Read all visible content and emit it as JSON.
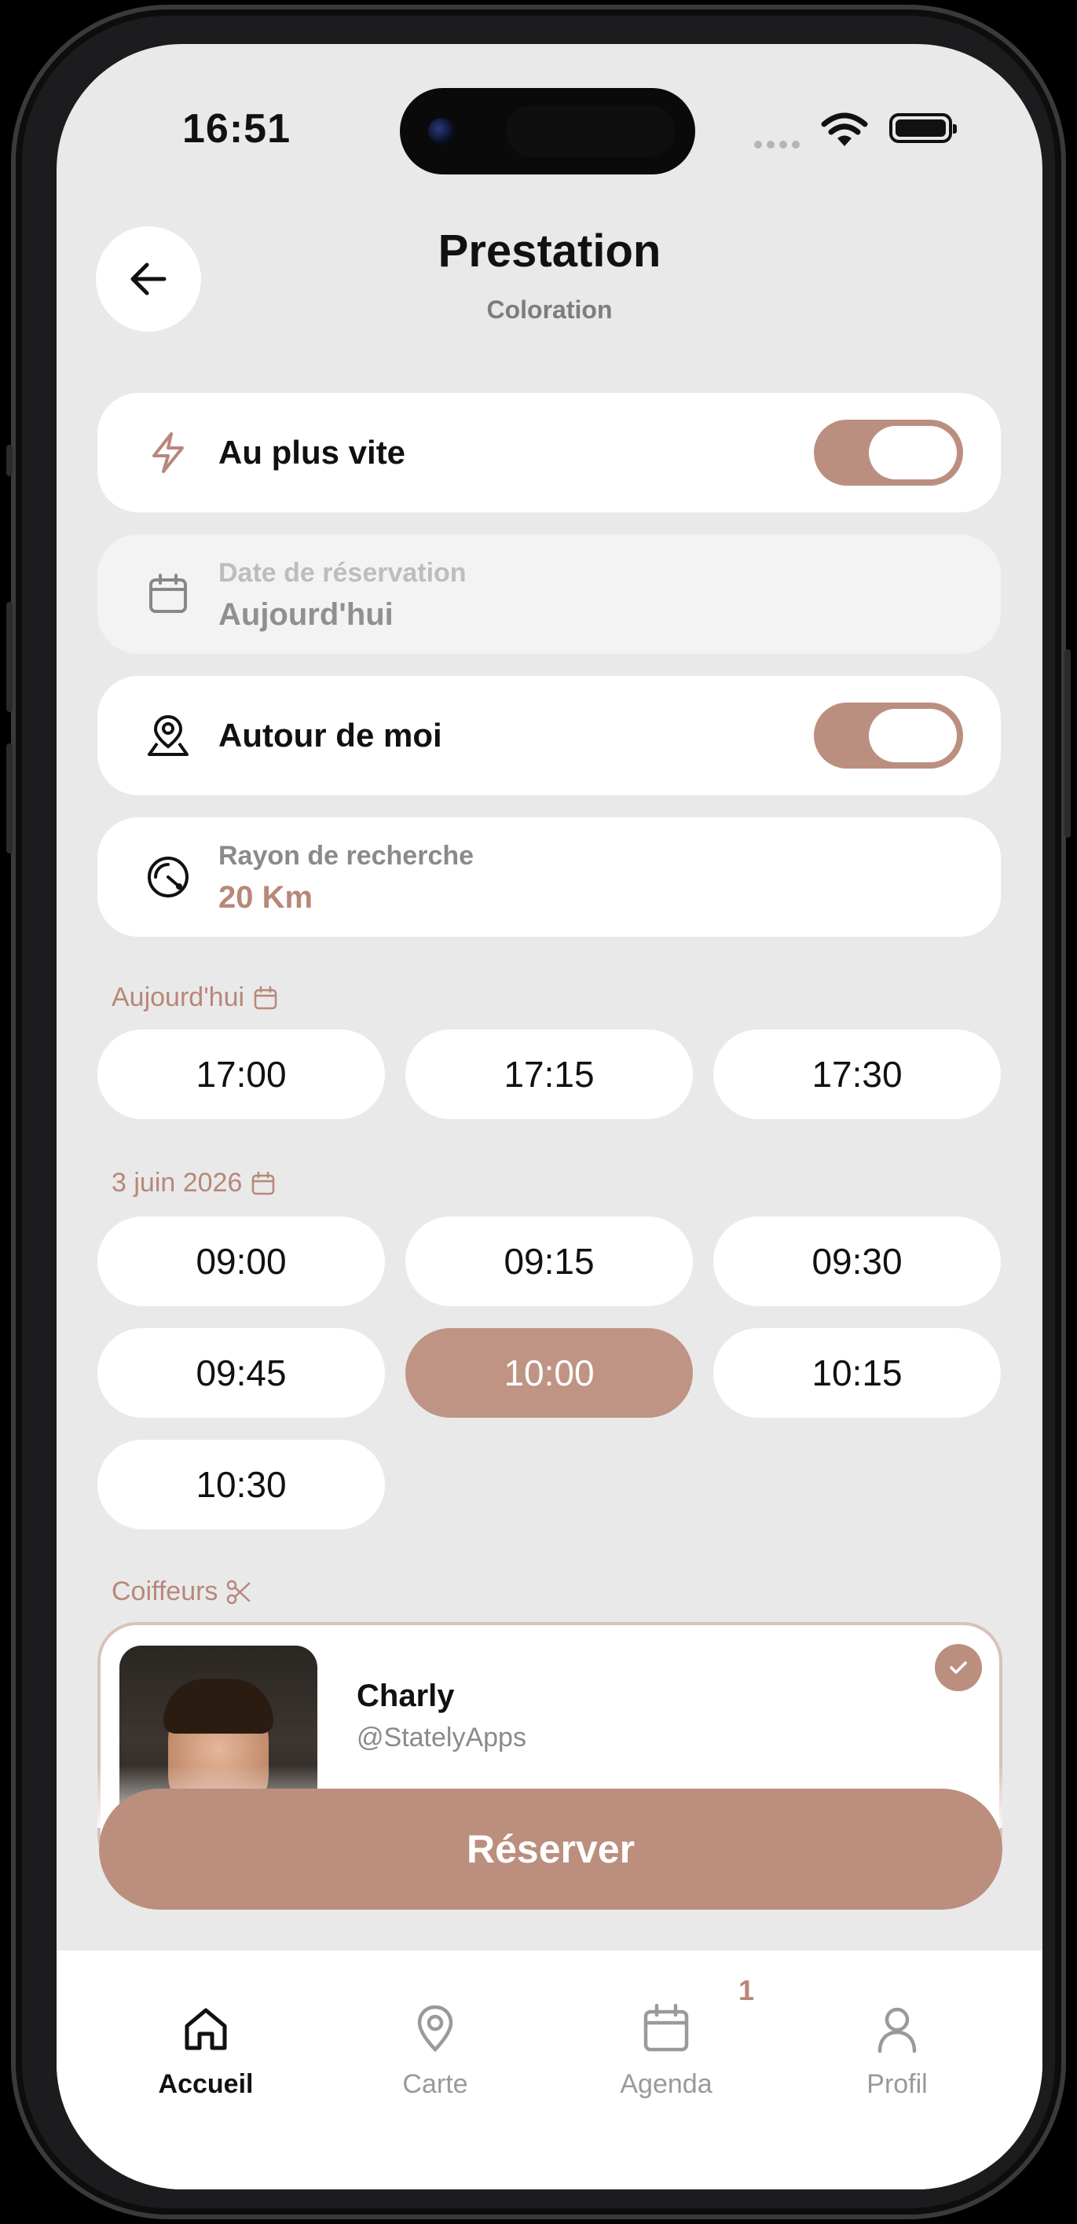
{
  "status_bar": {
    "time": "16:51"
  },
  "header": {
    "title": "Prestation",
    "subtitle": "Coloration"
  },
  "options": {
    "asap": {
      "label": "Au plus vite",
      "enabled": true,
      "icon": "lightning-icon"
    },
    "date": {
      "label": "Date de réservation",
      "value": "Aujourd'hui",
      "icon": "calendar-icon"
    },
    "nearby": {
      "label": "Autour de moi",
      "enabled": true,
      "icon": "map-pin-user-icon"
    },
    "radius": {
      "label": "Rayon de recherche",
      "value": "20 Km",
      "icon": "radar-icon"
    }
  },
  "slots": {
    "today": {
      "label": "Aujourd'hui",
      "times": [
        "17:00",
        "17:15",
        "17:30"
      ]
    },
    "june3": {
      "label": "3 juin 2026",
      "times": [
        "09:00",
        "09:15",
        "09:30",
        "09:45",
        "10:00",
        "10:15",
        "10:30"
      ],
      "selected": "10:00"
    }
  },
  "hairdressers": {
    "label": "Coiffeurs",
    "items": [
      {
        "name": "Charly",
        "handle": "@StatelyApps",
        "selected": true
      }
    ]
  },
  "actions": {
    "reserve_label": "Réserver"
  },
  "tabbar": {
    "items": [
      {
        "label": "Accueil",
        "icon": "home-icon",
        "active": true
      },
      {
        "label": "Carte",
        "icon": "map-pin-icon",
        "active": false
      },
      {
        "label": "Agenda",
        "icon": "calendar-icon",
        "active": false,
        "badge": "1"
      },
      {
        "label": "Profil",
        "icon": "user-icon",
        "active": false
      }
    ]
  },
  "colors": {
    "accent": "#BB8F7F",
    "background": "#E9E9E9",
    "card": "#FFFFFF"
  }
}
